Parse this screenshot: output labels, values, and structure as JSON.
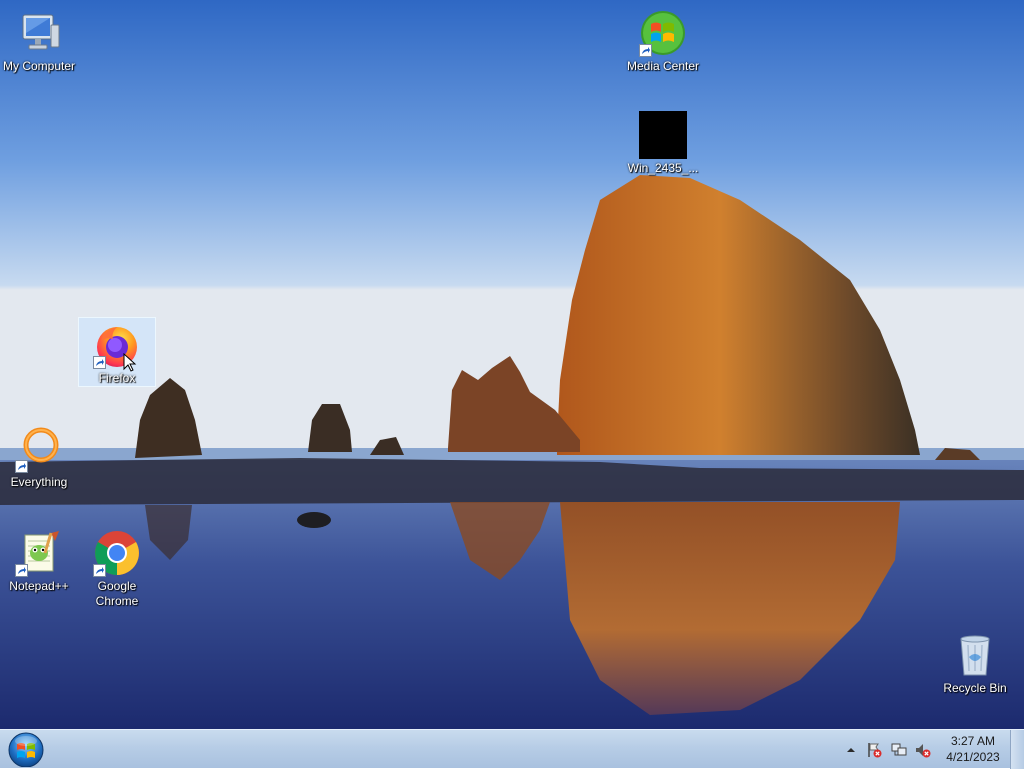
{
  "desktop": {
    "icons": [
      {
        "label": "My Computer"
      },
      {
        "label": "Media Center"
      },
      {
        "label": "Win_2435_..."
      },
      {
        "label": "Firefox"
      },
      {
        "label": "Everything"
      },
      {
        "label": "Notepad++"
      },
      {
        "label": "Google Chrome"
      },
      {
        "label": "Recycle Bin"
      }
    ]
  },
  "taskbar": {
    "clock_time": "3:27 AM",
    "clock_date": "4/21/2023",
    "tray_icons": [
      "show-hidden-icons-arrow",
      "action-center-flag-icon",
      "network-icon",
      "volume-muted-icon"
    ]
  },
  "colors": {
    "taskbar": "#b7cde6",
    "selection": "#c8e1ff",
    "sky_top": "#3a72c8"
  }
}
